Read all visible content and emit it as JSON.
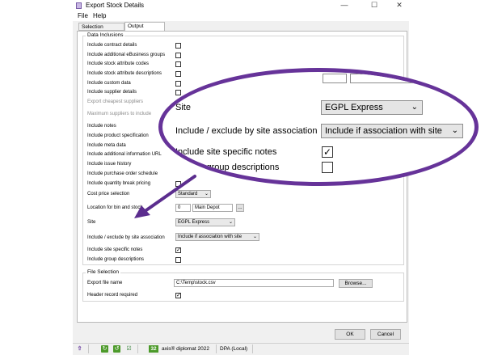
{
  "window": {
    "title": "Export Stock Details",
    "min": "—",
    "max": "☐",
    "close": "✕"
  },
  "menu": {
    "file": "File",
    "help": "Help"
  },
  "tabs": [
    {
      "label": "Selection Options"
    },
    {
      "label": "Output Options"
    }
  ],
  "data_inclusions": {
    "title": "Data Inclusions",
    "items": [
      {
        "label": "Include contract details",
        "checked": false,
        "enabled": true
      },
      {
        "label": "Include additional eBusiness groups",
        "checked": false,
        "enabled": true
      },
      {
        "label": "Include stock attribute codes",
        "checked": false,
        "enabled": true
      },
      {
        "label": "Include stock attribute descriptions",
        "checked": false,
        "enabled": true
      },
      {
        "label": "Include custom data",
        "checked": false,
        "enabled": true
      },
      {
        "label": "Include supplier details",
        "checked": false,
        "enabled": true
      },
      {
        "label": "Export cheapest suppliers",
        "checked": false,
        "enabled": false
      },
      {
        "label": "Maximum suppliers to include",
        "enabled": false
      },
      {
        "label": "Include notes",
        "checked": false,
        "enabled": true
      },
      {
        "label": "Include product specification",
        "checked": false,
        "enabled": true
      },
      {
        "label": "Include meta data",
        "checked": false,
        "enabled": true
      },
      {
        "label": "Include additional information URL",
        "checked": false,
        "enabled": true
      },
      {
        "label": "Include issue history",
        "checked": false,
        "enabled": true
      },
      {
        "label": "Include purchase order schedule",
        "checked": false,
        "enabled": true
      },
      {
        "label": "Include quantity break pricing",
        "checked": false,
        "enabled": true
      }
    ],
    "cost_price": {
      "label": "Cost price selection",
      "value": "Standard"
    },
    "location": {
      "label": "Location for bin and stock",
      "code": "0",
      "name": "Main Depot",
      "browse": "..."
    },
    "site": {
      "label": "Site",
      "value": "EGPL Express"
    },
    "site_assoc": {
      "label": "Include / exclude by site association",
      "value": "Include if association with site"
    },
    "site_notes": {
      "label": "Include site specific notes",
      "checked": true
    },
    "group_desc": {
      "label": "Include group descriptions",
      "checked": false
    }
  },
  "file_selection": {
    "title": "File Selection",
    "file_name_label": "Export file name",
    "file_name_value": "C:\\Temp\\stock.csv",
    "browse_label": "Browse...",
    "header_label": "Header record required",
    "header_checked": true
  },
  "buttons": {
    "ok": "OK",
    "cancel": "Cancel"
  },
  "statusbar": {
    "count": "32",
    "product": "axis® diplomat 2022",
    "db": "DPA (Local)"
  },
  "callout": {
    "site_label": "Site",
    "site_value": "EGPL Express",
    "assoc_label": "Include / exclude by site association",
    "assoc_value": "Include if association with site",
    "notes_label": "Include site specific notes",
    "notes_checked": true,
    "group_label": "Include group descriptions",
    "group_checked": false
  },
  "colors": {
    "callout_border": "#663399",
    "arrow": "#5b2d8e"
  }
}
